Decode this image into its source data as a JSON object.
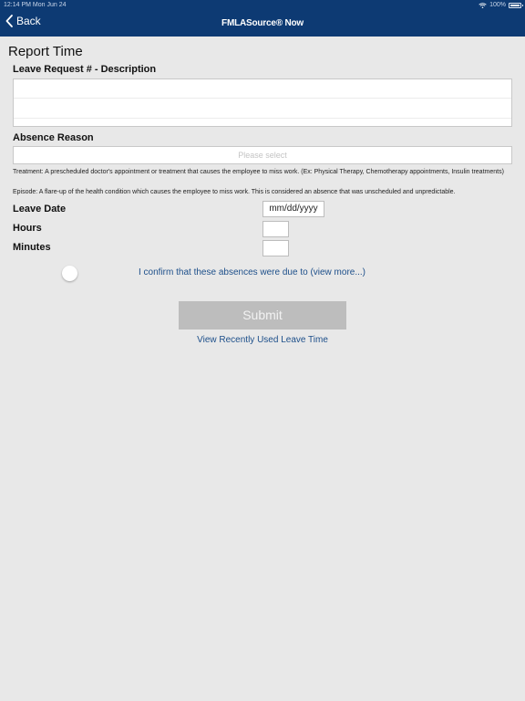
{
  "status_bar": {
    "time": "12:14 PM  Mon Jun 24",
    "battery": "100%"
  },
  "header": {
    "back_label": "Back",
    "title": "FMLASource® Now"
  },
  "page": {
    "title": "Report Time"
  },
  "form": {
    "leave_request_label": "Leave Request # - Description",
    "absence_reason_label": "Absence Reason",
    "absence_reason_placeholder": "Please select",
    "treatment_help": "Treatment: A prescheduled doctor's appointment or treatment that causes the employee to miss work. (Ex: Physical Therapy, Chemotherapy appointments, Insulin treatments)",
    "episode_help": "Episode: A flare-up of the health condition which causes the employee to miss work. This is considered an absence that was unscheduled and unpredictable.",
    "leave_date_label": "Leave Date",
    "leave_date_placeholder": "mm/dd/yyyy",
    "hours_label": "Hours",
    "minutes_label": "Minutes",
    "confirm_text": "I confirm that these absences were due to (view more...)",
    "submit_label": "Submit",
    "recent_link": "View Recently Used Leave Time"
  },
  "colors": {
    "header_bg": "#0d3a73",
    "link": "#1d4f8a",
    "submit_disabled": "#bdbdbd",
    "background": "#e8e8e8"
  }
}
